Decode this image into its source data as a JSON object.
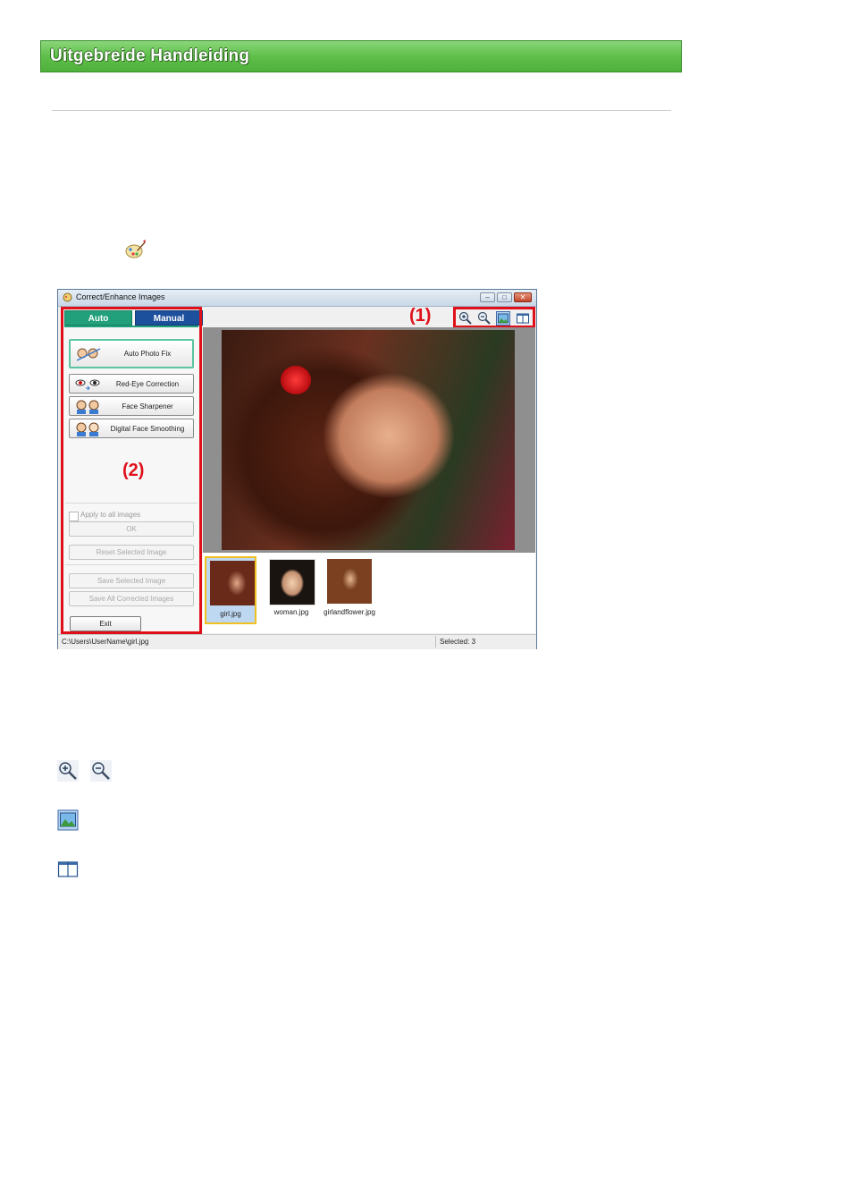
{
  "header": {
    "title": "Uitgebreide Handleiding"
  },
  "window": {
    "title": "Correct/Enhance Images",
    "tabs": {
      "auto": "Auto",
      "manual": "Manual"
    },
    "buttons": {
      "auto_photo_fix": "Auto Photo Fix",
      "red_eye": "Red-Eye Correction",
      "face_sharpener": "Face Sharpener",
      "digital_face_smoothing": "Digital Face Smoothing"
    },
    "apply_to_all": "Apply to all images",
    "ok": "OK",
    "reset_selected": "Reset Selected Image",
    "save_selected": "Save Selected Image",
    "save_all": "Save All Corrected Images",
    "exit": "Exit",
    "thumbnails": [
      "girl.jpg",
      "woman.jpg",
      "girlandflower.jpg"
    ],
    "status": {
      "path": "C:\\Users\\UserName\\girl.jpg",
      "selected": "Selected: 3"
    }
  },
  "callouts": {
    "one": "(1)",
    "two": "(2)"
  },
  "colors": {
    "banner": "#5fbf4a",
    "callout_red": "#e0101a",
    "tab_auto": "#21a07b",
    "tab_manual": "#1c4f9c"
  }
}
